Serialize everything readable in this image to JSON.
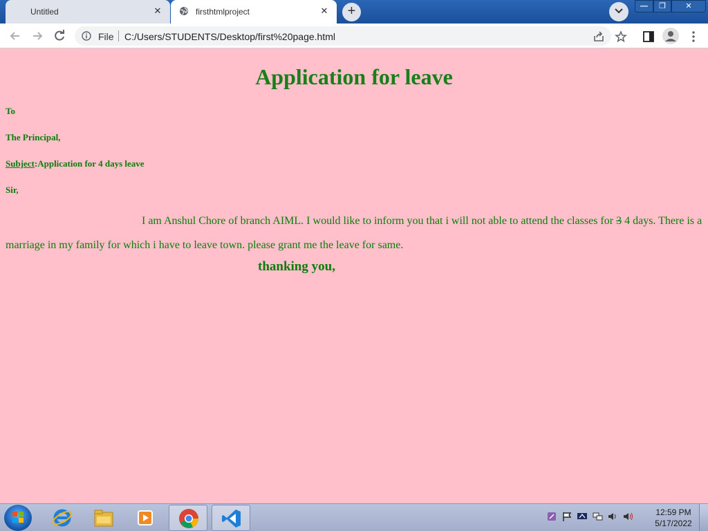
{
  "browser": {
    "tabs": [
      {
        "title": "Untitled",
        "active": false
      },
      {
        "title": "firsthtmlproject",
        "active": true
      }
    ],
    "address": {
      "scheme_label": "File",
      "url": "C:/Users/STUDENTS/Desktop/first%20page.html"
    }
  },
  "page": {
    "background": "#ffc0cb",
    "text_color": "#0a7d0a",
    "heading": "Application for leave",
    "to": "To",
    "recipient": "The Principal,",
    "subject_label": "Subject",
    "subject_text": ":Application for 4 days leave",
    "salutation": "Sir,",
    "body_part1": "I am Anshul Chore of branch AIML. I would like to inform you that i will not able to attend the classes for ",
    "body_struck": "3",
    "body_part2": " 4 days. There is a marriage in my family for which i have to leave town. please grant me the leave for same.",
    "closing": "thanking you,"
  },
  "taskbar": {
    "clock_time": "12:59 PM",
    "clock_date": "5/17/2022",
    "apps": [
      "internet-explorer",
      "file-explorer",
      "media-player",
      "chrome",
      "vscode"
    ]
  }
}
